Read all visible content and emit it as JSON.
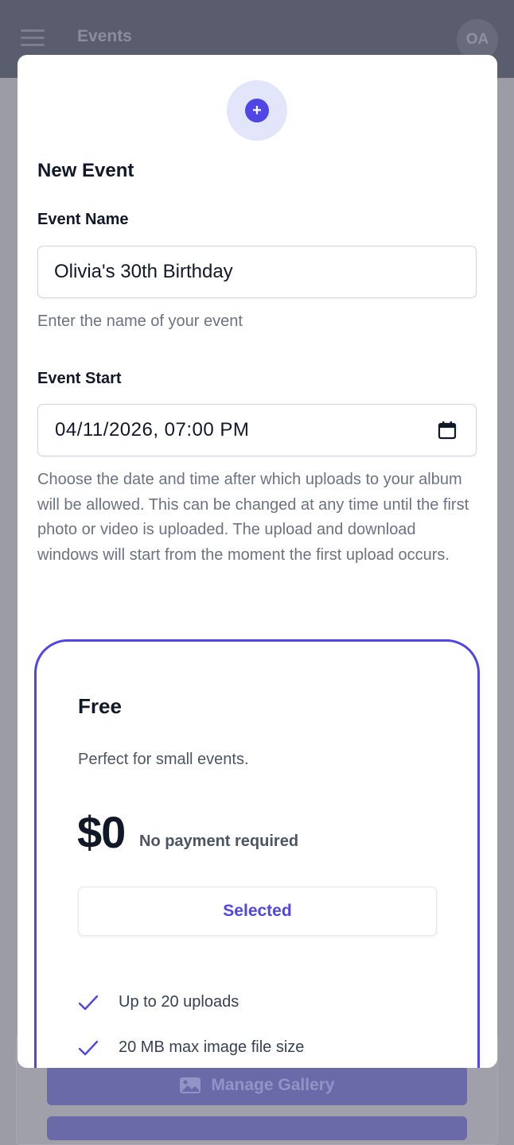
{
  "app": {
    "title": "Events",
    "avatar_initials": "OA",
    "manage_gallery_label": "Manage Gallery"
  },
  "modal": {
    "title": "New Event",
    "event_name": {
      "label": "Event Name",
      "value": "Olivia's 30th Birthday",
      "help": "Enter the name of your event"
    },
    "event_start": {
      "label": "Event Start",
      "value": "04/11/2026, 07:00 PM",
      "help": "Choose the date and time after which uploads to your album will be allowed. This can be changed at any time until the first photo or video is uploaded. The upload and download windows will start from the moment the first upload occurs."
    },
    "plan": {
      "name": "Free",
      "description": "Perfect for small events.",
      "price": "$0",
      "price_note": "No payment required",
      "button_label": "Selected",
      "features": [
        "Up to 20 uploads",
        "20 MB max image file size"
      ]
    }
  },
  "colors": {
    "accent": "#4f46e5",
    "accent_light": "#e3e5fb",
    "overlay_bg": "#9b9ca6",
    "text_primary": "#111827",
    "text_muted": "#6b7280"
  },
  "icons": {
    "menu": "menu-icon",
    "new_event": "plus-icon",
    "calendar": "calendar-icon",
    "check": "check-icon",
    "gallery": "image-icon"
  }
}
